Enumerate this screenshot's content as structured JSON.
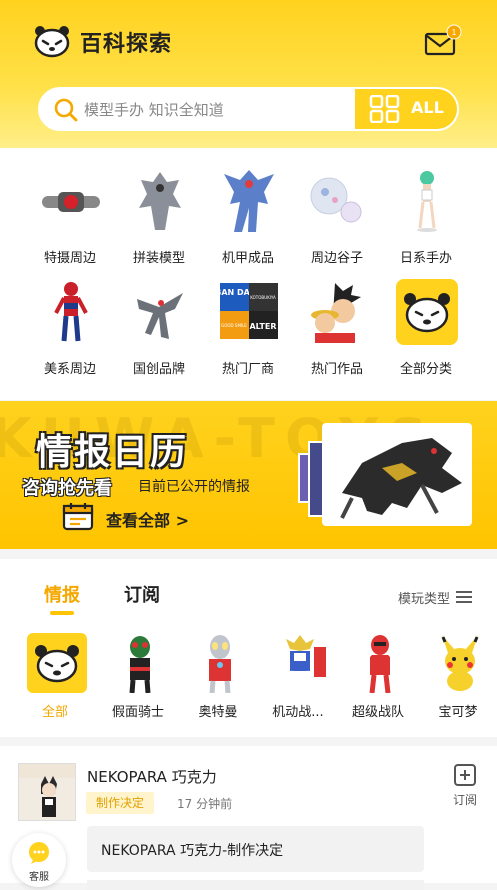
{
  "header": {
    "title": "百科探索",
    "mail_badge": "1"
  },
  "search": {
    "placeholder": "模型手办 知识全知道",
    "all_label": "ALL"
  },
  "categories": [
    {
      "label": "特摄周边"
    },
    {
      "label": "拼装模型"
    },
    {
      "label": "机甲成品"
    },
    {
      "label": "周边谷子"
    },
    {
      "label": "日系手办"
    },
    {
      "label": "美系周边"
    },
    {
      "label": "国创品牌"
    },
    {
      "label": "热门厂商"
    },
    {
      "label": "热门作品"
    },
    {
      "label": "全部分类"
    }
  ],
  "banner": {
    "watermark": "KUWA-TOYS",
    "title": "情报日历",
    "subtitle_bold": "咨询抢先看",
    "subtitle": "目前已公开的情报",
    "link": "查看全部 >",
    "brand_logos": [
      "BAN DAI",
      "KOTOBUKIYA",
      "ALTER",
      "GOOD SMILE"
    ]
  },
  "news": {
    "tabs": [
      {
        "label": "情报"
      },
      {
        "label": "订阅"
      }
    ],
    "filter_label": "模玩类型",
    "chips": [
      {
        "label": "全部"
      },
      {
        "label": "假面骑士"
      },
      {
        "label": "奥特曼"
      },
      {
        "label": "机动战..."
      },
      {
        "label": "超级战队"
      },
      {
        "label": "宝可梦"
      }
    ]
  },
  "feed": {
    "title": "NEKOPARA 巧克力",
    "tag": "制作决定",
    "time": "17 分钟前",
    "subscribe": "订阅",
    "headline": "NEKOPARA 巧克力-制作决定"
  },
  "service": {
    "label": "客服"
  },
  "colors": {
    "accent": "#ffd21e",
    "active": "#f5a800"
  }
}
